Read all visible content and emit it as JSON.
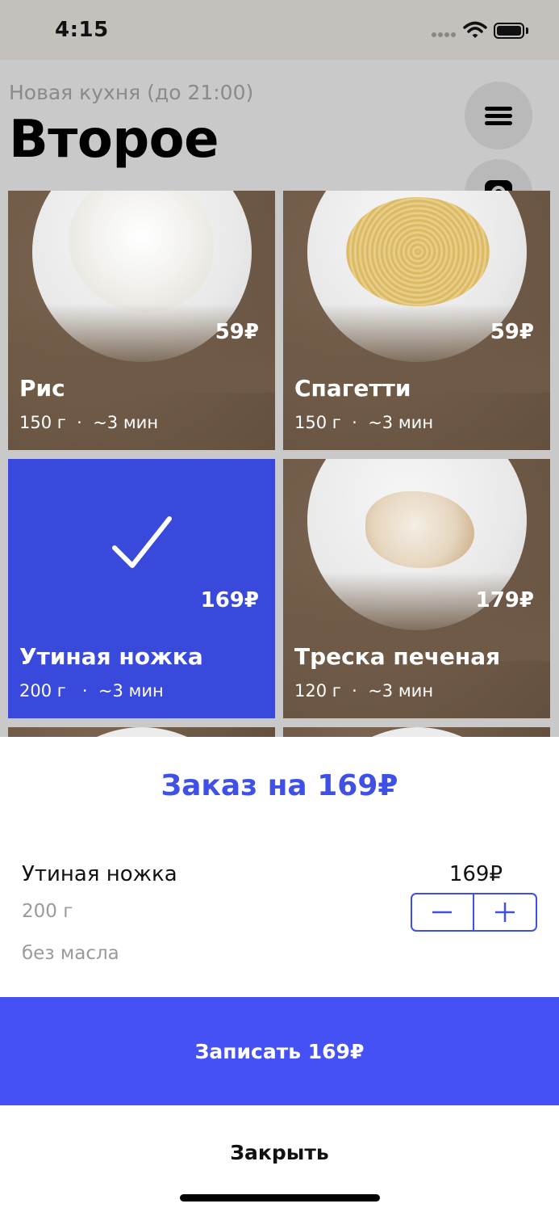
{
  "status_bar": {
    "time": "4:15"
  },
  "header": {
    "kitchen": "Новая кухня (до 21:00)",
    "title": "Второе"
  },
  "icons": {
    "menu": "menu-icon",
    "camera": "camera-icon",
    "check": "check-icon"
  },
  "dishes": [
    {
      "name": "Рис",
      "weight": "150 г",
      "time": "~3 мин",
      "price": "59₽",
      "selected": false
    },
    {
      "name": "Спагетти",
      "weight": "150 г",
      "time": "~3 мин",
      "price": "59₽",
      "selected": false
    },
    {
      "name": "Утиная ножка",
      "weight": "200 г",
      "time": "~3 мин",
      "price": "169₽",
      "selected": true
    },
    {
      "name": "Треска печеная",
      "weight": "120 г",
      "time": "~3 мин",
      "price": "179₽",
      "selected": false
    }
  ],
  "meta_separator": "·",
  "order": {
    "title": "Заказ на 169₽",
    "item_name": "Утиная ножка",
    "item_price": "169₽",
    "item_weight": "200 г",
    "item_note": "без масла",
    "submit_label": "Записать 169₽",
    "close_label": "Закрыть"
  },
  "colors": {
    "accent": "#3f50e6",
    "button": "#4551f5",
    "selected_card": "#3949dc",
    "card_brown": "#6d5846"
  }
}
